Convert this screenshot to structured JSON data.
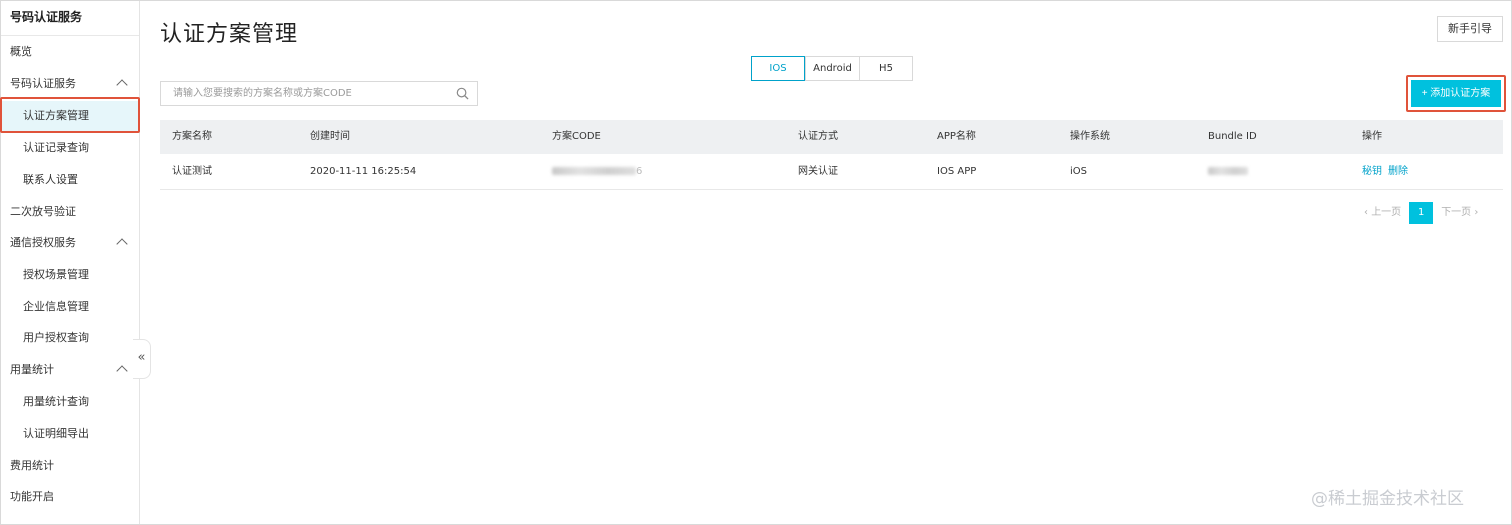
{
  "sidebar": {
    "title": "号码认证服务",
    "items": [
      {
        "label": "概览"
      },
      {
        "label": "号码认证服务"
      },
      {
        "label": "认证方案管理"
      },
      {
        "label": "认证记录查询"
      },
      {
        "label": "联系人设置"
      },
      {
        "label": "二次放号验证"
      },
      {
        "label": "通信授权服务"
      },
      {
        "label": "授权场景管理"
      },
      {
        "label": "企业信息管理"
      },
      {
        "label": "用户授权查询"
      },
      {
        "label": "用量统计"
      },
      {
        "label": "用量统计查询"
      },
      {
        "label": "认证明细导出"
      },
      {
        "label": "费用统计"
      },
      {
        "label": "功能开启"
      }
    ],
    "collapse_glyph": "«"
  },
  "header": {
    "title": "认证方案管理",
    "guide_label": "新手引导"
  },
  "tabs": [
    {
      "label": "IOS"
    },
    {
      "label": "Android"
    },
    {
      "label": "H5"
    }
  ],
  "search": {
    "placeholder": "请输入您要搜索的方案名称或方案CODE"
  },
  "add_button": {
    "label": "+ 添加认证方案"
  },
  "table": {
    "columns": [
      "方案名称",
      "创建时间",
      "方案CODE",
      "认证方式",
      "APP名称",
      "操作系统",
      "Bundle ID",
      "操作"
    ],
    "rows": [
      {
        "name": "认证测试",
        "created": "2020-11-11 16:25:54",
        "code_suffix": "6",
        "auth_method": "网关认证",
        "app_name": "IOS APP",
        "os": "iOS",
        "actions": [
          "秘钥",
          "删除"
        ]
      }
    ]
  },
  "pagination": {
    "prev": "上一页",
    "current": "1",
    "next": "下一页"
  },
  "watermark": "@稀土掘金技术社区",
  "colors": {
    "accent": "#00c1de",
    "link": "#00a2ca",
    "highlight_border": "#e0533a",
    "active_bg": "#e6f6fa"
  }
}
